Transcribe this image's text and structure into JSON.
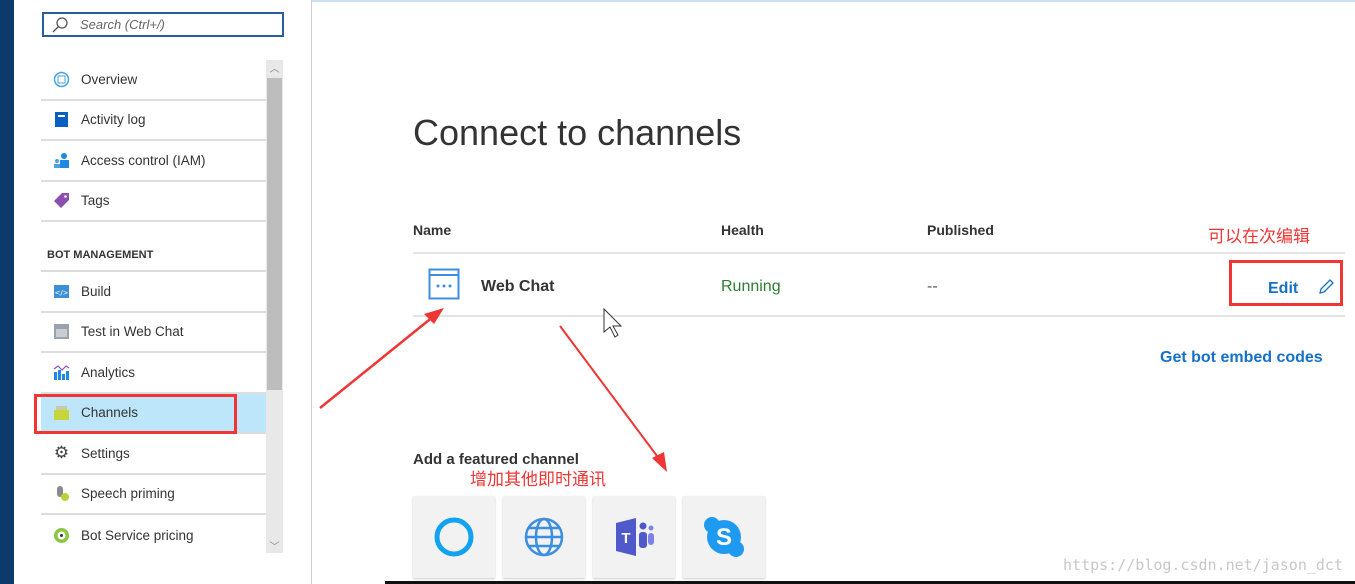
{
  "sidebar": {
    "search_placeholder": "Search (Ctrl+/)",
    "items": [
      {
        "label": "Overview",
        "icon": "overview-icon"
      },
      {
        "label": "Activity log",
        "icon": "book-icon"
      },
      {
        "label": "Access control (IAM)",
        "icon": "users-icon"
      },
      {
        "label": "Tags",
        "icon": "tag-icon"
      }
    ],
    "section": "BOT MANAGEMENT",
    "bot_items": [
      {
        "label": "Build",
        "icon": "code-icon"
      },
      {
        "label": "Test in Web Chat",
        "icon": "webchat-icon"
      },
      {
        "label": "Analytics",
        "icon": "chart-icon"
      },
      {
        "label": "Channels",
        "icon": "channels-icon",
        "active": true
      },
      {
        "label": "Settings",
        "icon": "gear-icon"
      },
      {
        "label": "Speech priming",
        "icon": "mic-icon"
      },
      {
        "label": "Bot Service pricing",
        "icon": "pricing-icon"
      }
    ]
  },
  "main": {
    "title": "Connect to channels",
    "columns": [
      "Name",
      "Health",
      "Published"
    ],
    "row": {
      "name": "Web Chat",
      "health": "Running",
      "published": "--",
      "edit": "Edit"
    },
    "embed_link": "Get bot embed codes",
    "featured_title": "Add a featured channel",
    "featured": [
      "Cortana",
      "Direct Line / Web",
      "Microsoft Teams",
      "Skype"
    ]
  },
  "annotations": {
    "edit_note": "可以在次编辑",
    "add_note": "增加其他即时通讯"
  },
  "watermark": "https://blog.csdn.net/jason_dct",
  "colors": {
    "accent": "#1570c8",
    "running": "#2e7d32",
    "annotation": "#f03535",
    "active": "#bde6fb"
  }
}
